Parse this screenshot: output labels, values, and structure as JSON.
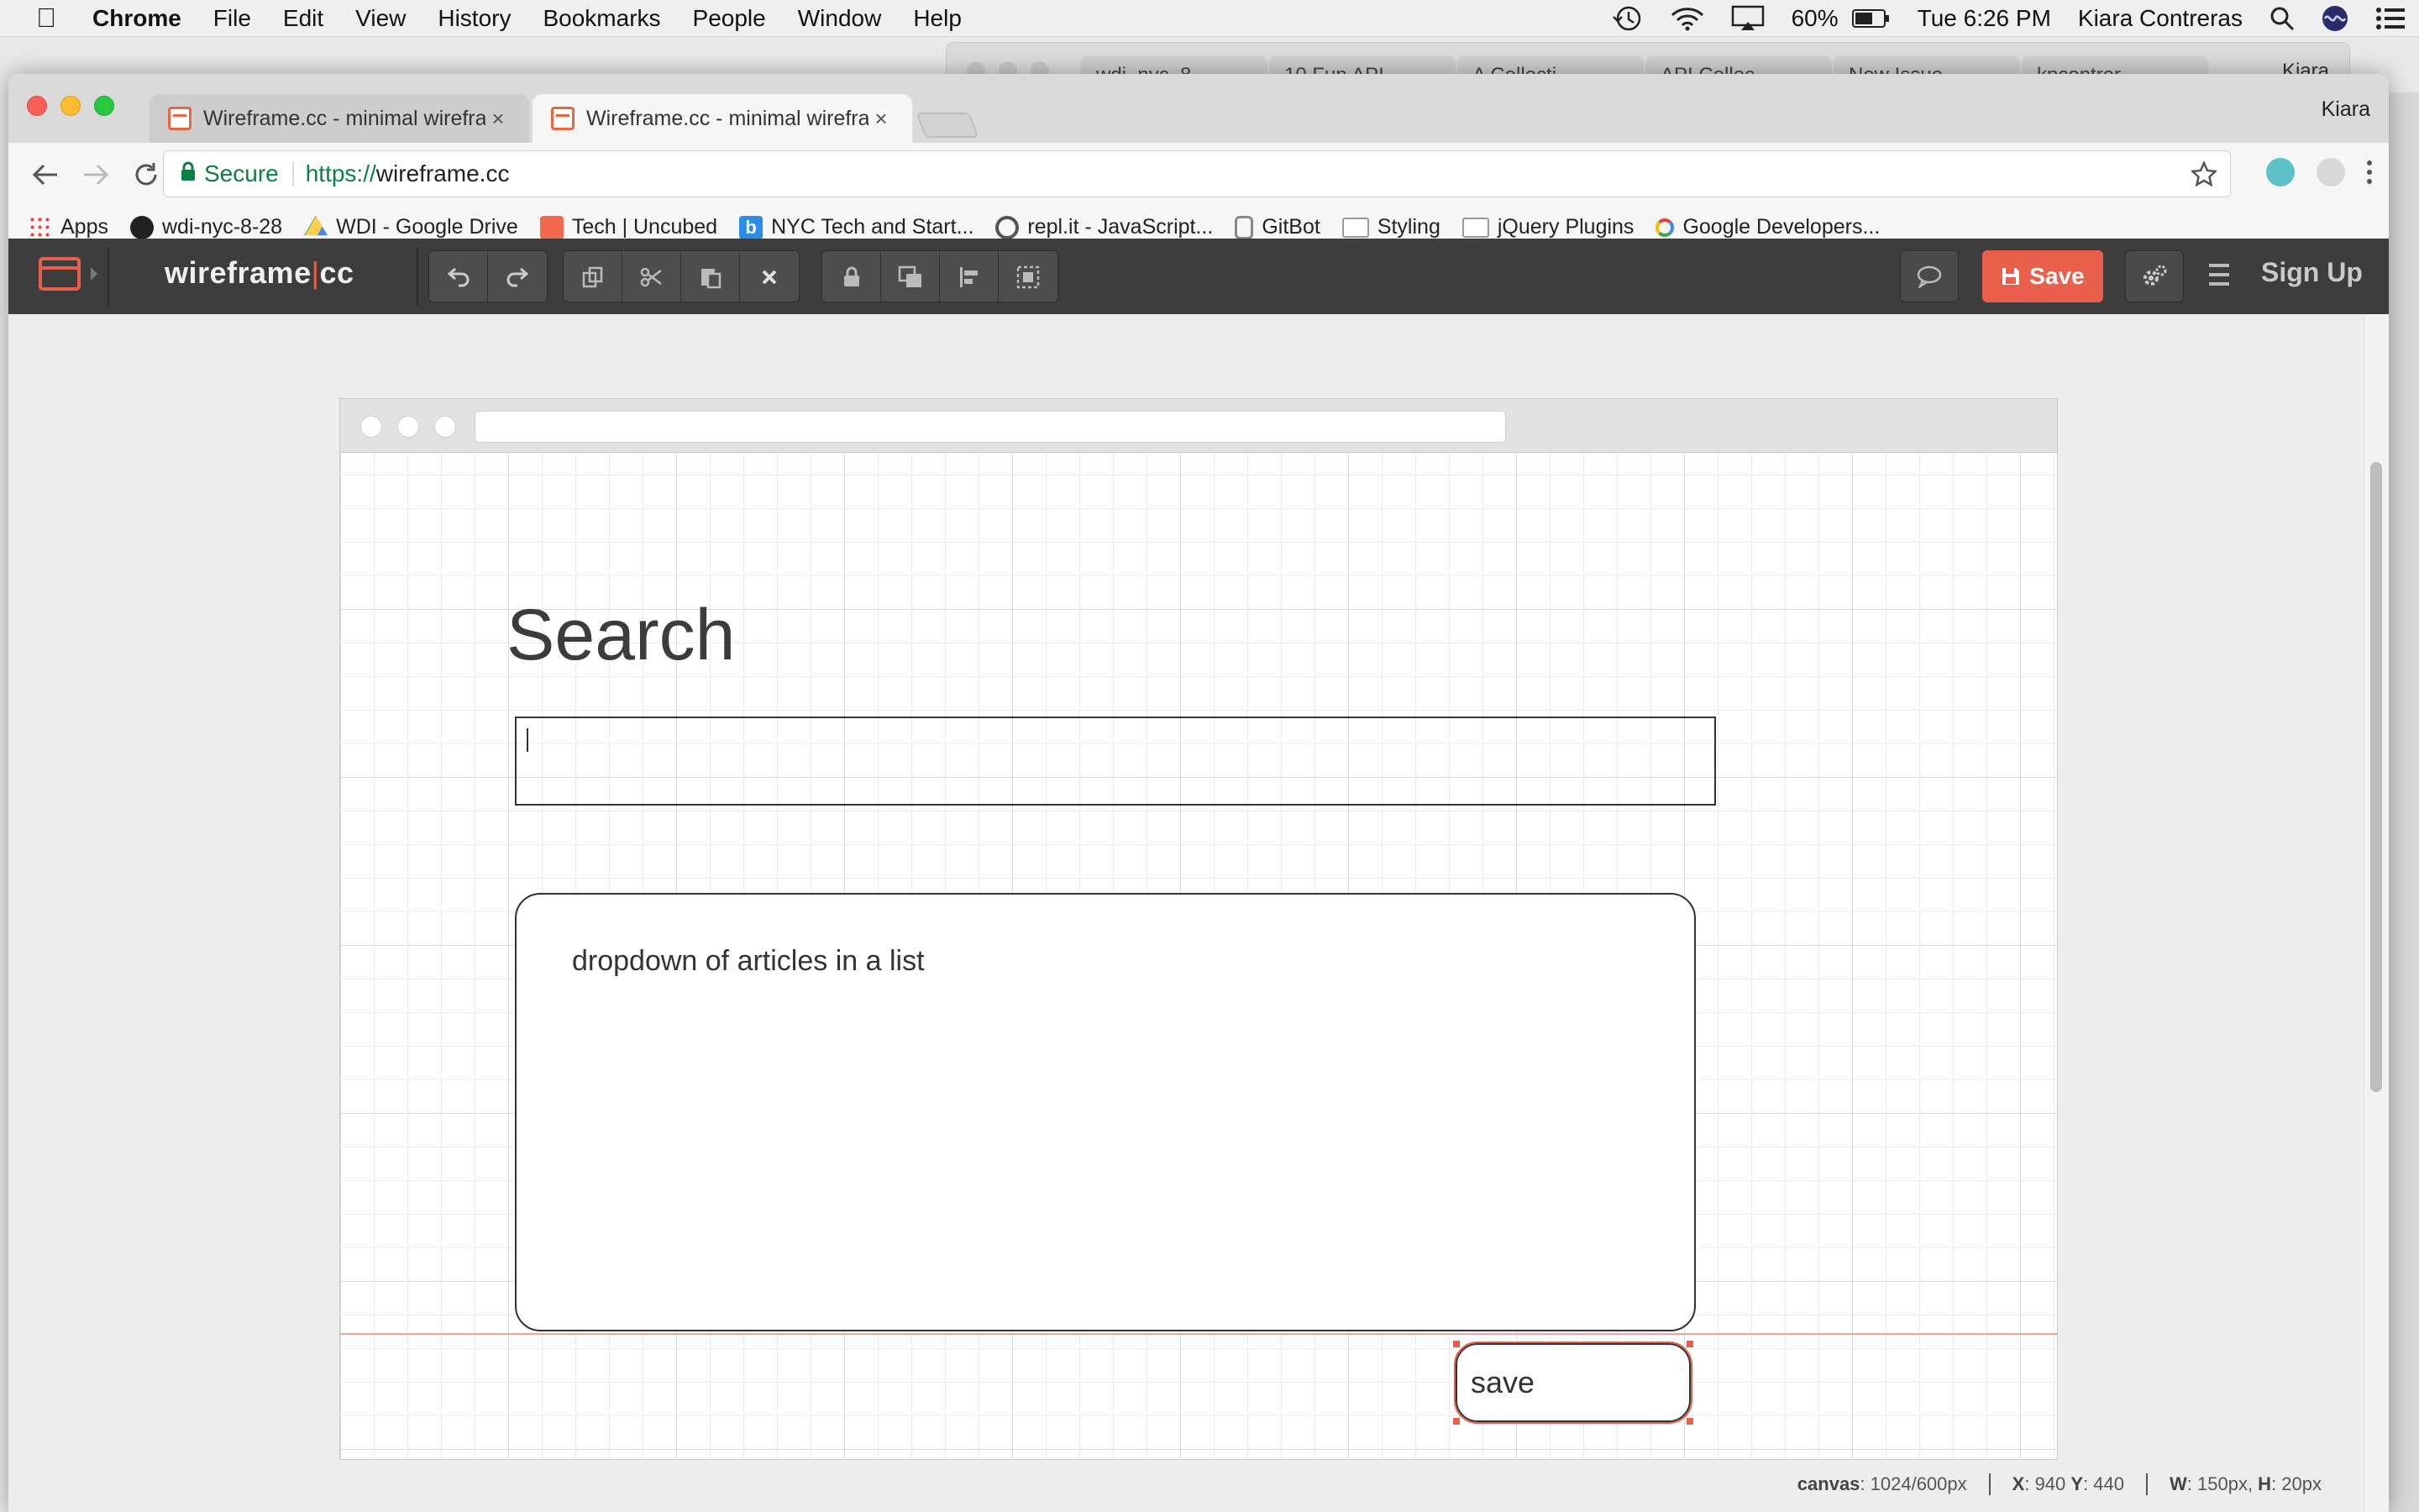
{
  "menubar": {
    "app_name": "Chrome",
    "items": [
      "File",
      "Edit",
      "View",
      "History",
      "Bookmarks",
      "People",
      "Window",
      "Help"
    ],
    "battery": "60%",
    "clock": "Tue 6:26 PM",
    "user": "Kiara Contreras"
  },
  "background_window": {
    "tabs": [
      "wdi_nyc_8",
      "10 Fun API",
      "A Collecti",
      "API Collec",
      "New Issue",
      "kpcontrer"
    ],
    "profile": "Kiara"
  },
  "browser": {
    "tabs": [
      {
        "title": "Wireframe.cc - minimal wirefra",
        "active": false
      },
      {
        "title": "Wireframe.cc - minimal wirefra",
        "active": true
      }
    ],
    "profile": "Kiara",
    "secure_label": "Secure",
    "url_scheme": "https://",
    "url_host": "wireframe.cc",
    "bookmarks": [
      {
        "label": "Apps",
        "icon": "apps-icon"
      },
      {
        "label": "wdi-nyc-8-28",
        "icon": "github-icon"
      },
      {
        "label": "WDI - Google Drive",
        "icon": "drive-icon"
      },
      {
        "label": "Tech | Uncubed",
        "icon": "uncubed-icon"
      },
      {
        "label": "NYC Tech and Start...",
        "icon": "b-icon"
      },
      {
        "label": "repl.it - JavaScript...",
        "icon": "replit-icon"
      },
      {
        "label": "GitBot",
        "icon": "gitbot-icon"
      },
      {
        "label": "Styling",
        "icon": "folder-icon"
      },
      {
        "label": "jQuery Plugins",
        "icon": "folder-icon"
      },
      {
        "label": "Google Developers...",
        "icon": "google-dev-icon"
      }
    ]
  },
  "app": {
    "brand_left": "wireframe",
    "brand_pipe": "|",
    "brand_right": "cc",
    "save_label": "Save",
    "signup_label": "Sign Up",
    "colors": {
      "accent": "#e8604c",
      "bar": "#3d3d3d"
    }
  },
  "canvas": {
    "heading": "Search",
    "panel_text": "dropdown of articles in a list",
    "button_text": "save"
  },
  "status": {
    "canvas_label": "canvas",
    "canvas_value": ": 1024/600px",
    "x_label": "X",
    "x_value": ": 940 ",
    "y_label": "Y",
    "y_value": ": 440",
    "w_label": "W",
    "w_value": ": 150px, ",
    "h_label": "H",
    "h_value": ": 20px"
  }
}
